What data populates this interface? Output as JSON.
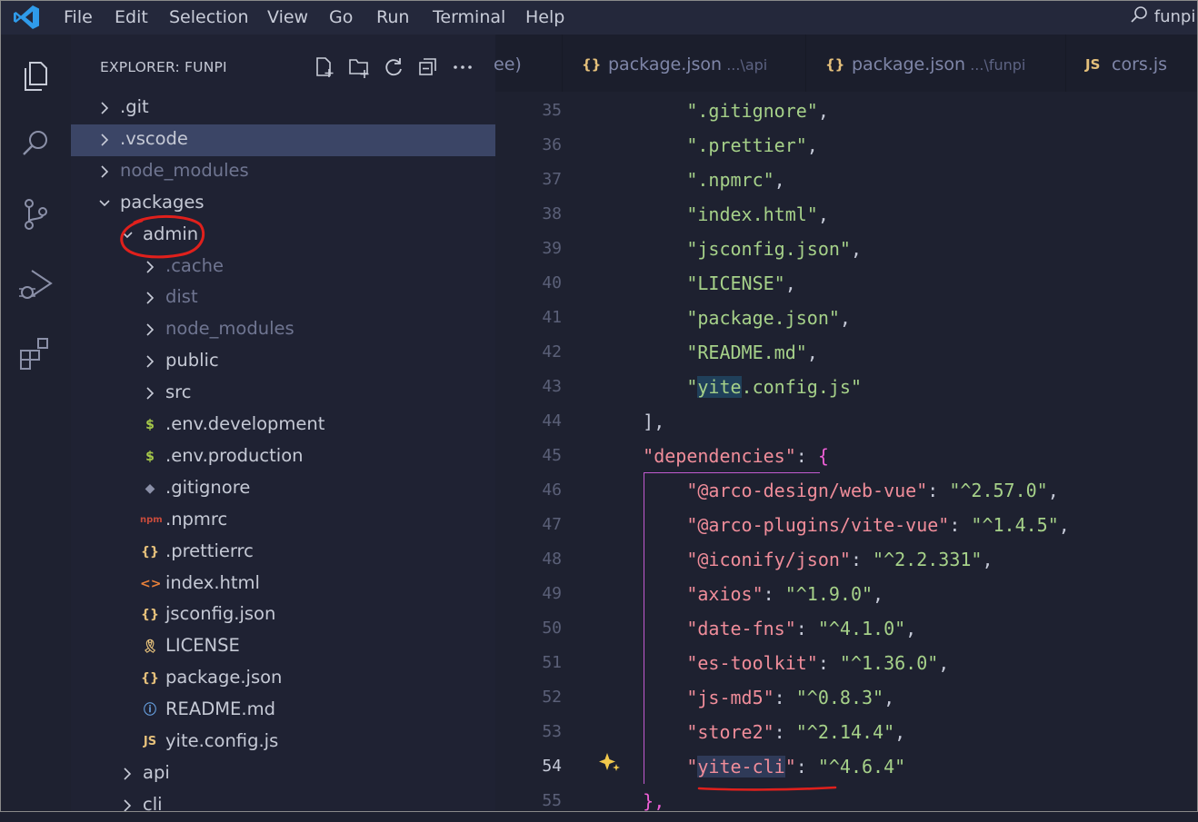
{
  "titlebar": {
    "menu": [
      "File",
      "Edit",
      "Selection",
      "View",
      "Go",
      "Run",
      "Terminal",
      "Help"
    ],
    "search_text": "funpi"
  },
  "activitybar": {
    "items": [
      "explorer-icon",
      "search-icon",
      "source-control-icon",
      "run-debug-icon",
      "extensions-icon"
    ]
  },
  "sidebar": {
    "title": "EXPLORER: FUNPI",
    "actions": [
      "new-file-icon",
      "new-folder-icon",
      "refresh-icon",
      "collapse-all-icon",
      "more-icon"
    ],
    "tree": [
      {
        "label": ".git",
        "kind": "folder",
        "expanded": false
      },
      {
        "label": ".vscode",
        "kind": "folder",
        "expanded": false,
        "selected": true
      },
      {
        "label": "node_modules",
        "kind": "folder",
        "expanded": false,
        "dim": true
      },
      {
        "label": "packages",
        "kind": "folder",
        "expanded": true
      },
      {
        "label": "admin",
        "kind": "folder",
        "expanded": true
      },
      {
        "label": ".cache",
        "kind": "folder",
        "expanded": false,
        "dim": true
      },
      {
        "label": "dist",
        "kind": "folder",
        "expanded": false,
        "dim": true
      },
      {
        "label": "node_modules",
        "kind": "folder",
        "expanded": false,
        "dim": true
      },
      {
        "label": "public",
        "kind": "folder",
        "expanded": false
      },
      {
        "label": "src",
        "kind": "folder",
        "expanded": false
      },
      {
        "label": ".env.development",
        "kind": "env",
        "glyph": "$"
      },
      {
        "label": ".env.production",
        "kind": "env",
        "glyph": "$"
      },
      {
        "label": ".gitignore",
        "kind": "git",
        "glyph": "◆"
      },
      {
        "label": ".npmrc",
        "kind": "npm",
        "glyph": "npm"
      },
      {
        "label": ".prettierrc",
        "kind": "json",
        "glyph": "{}"
      },
      {
        "label": "index.html",
        "kind": "html",
        "glyph": "<>"
      },
      {
        "label": "jsconfig.json",
        "kind": "json",
        "glyph": "{}"
      },
      {
        "label": "LICENSE",
        "kind": "license",
        "glyph": "🎗"
      },
      {
        "label": "package.json",
        "kind": "json",
        "glyph": "{}"
      },
      {
        "label": "README.md",
        "kind": "info",
        "glyph": "ⓘ"
      },
      {
        "label": "yite.config.js",
        "kind": "js",
        "glyph": "JS"
      },
      {
        "label": "api",
        "kind": "folder",
        "expanded": false
      },
      {
        "label": "cli",
        "kind": "folder",
        "expanded": false
      }
    ]
  },
  "tabs": [
    {
      "name": "ee)",
      "path": "",
      "icon": ""
    },
    {
      "name": "package.json",
      "path": "...\\api",
      "icon": "{}"
    },
    {
      "name": "package.json",
      "path": "...\\funpi",
      "icon": "{}"
    },
    {
      "name": "cors.js",
      "path": "",
      "icon": "JS"
    }
  ],
  "code": {
    "active_line": "54",
    "lines": [
      {
        "n": "35",
        "parts": [
          {
            "t": "        "
          },
          {
            "t": "\".gitignore\"",
            "c": "str"
          },
          {
            "t": ",",
            "c": "pun"
          }
        ]
      },
      {
        "n": "36",
        "parts": [
          {
            "t": "        "
          },
          {
            "t": "\".prettier\"",
            "c": "str"
          },
          {
            "t": ",",
            "c": "pun"
          }
        ]
      },
      {
        "n": "37",
        "parts": [
          {
            "t": "        "
          },
          {
            "t": "\".npmrc\"",
            "c": "str"
          },
          {
            "t": ",",
            "c": "pun"
          }
        ]
      },
      {
        "n": "38",
        "parts": [
          {
            "t": "        "
          },
          {
            "t": "\"index.html\"",
            "c": "str"
          },
          {
            "t": ",",
            "c": "pun"
          }
        ]
      },
      {
        "n": "39",
        "parts": [
          {
            "t": "        "
          },
          {
            "t": "\"jsconfig.json\"",
            "c": "str"
          },
          {
            "t": ",",
            "c": "pun"
          }
        ]
      },
      {
        "n": "40",
        "parts": [
          {
            "t": "        "
          },
          {
            "t": "\"LICENSE\"",
            "c": "str"
          },
          {
            "t": ",",
            "c": "pun"
          }
        ]
      },
      {
        "n": "41",
        "parts": [
          {
            "t": "        "
          },
          {
            "t": "\"package.json\"",
            "c": "str"
          },
          {
            "t": ",",
            "c": "pun"
          }
        ]
      },
      {
        "n": "42",
        "parts": [
          {
            "t": "        "
          },
          {
            "t": "\"README.md\"",
            "c": "str"
          },
          {
            "t": ",",
            "c": "pun"
          }
        ]
      },
      {
        "n": "43",
        "parts": [
          {
            "t": "        "
          },
          {
            "t": "\"",
            "c": "str"
          },
          {
            "t": "yite",
            "c": "str",
            "hl": "hl"
          },
          {
            "t": ".config.js\"",
            "c": "str"
          }
        ]
      },
      {
        "n": "44",
        "parts": [
          {
            "t": "    "
          },
          {
            "t": "],",
            "c": "pun"
          }
        ]
      },
      {
        "n": "45",
        "parts": [
          {
            "t": "    "
          },
          {
            "t": "\"dependencies\"",
            "c": "key"
          },
          {
            "t": ": ",
            "c": "pun"
          },
          {
            "t": "{",
            "c": "brace"
          }
        ]
      },
      {
        "n": "46",
        "parts": [
          {
            "t": "        "
          },
          {
            "t": "\"@arco-design/web-vue\"",
            "c": "key"
          },
          {
            "t": ": ",
            "c": "pun"
          },
          {
            "t": "\"^2.57.0\"",
            "c": "str"
          },
          {
            "t": ",",
            "c": "pun"
          }
        ]
      },
      {
        "n": "47",
        "parts": [
          {
            "t": "        "
          },
          {
            "t": "\"@arco-plugins/vite-vue\"",
            "c": "key"
          },
          {
            "t": ": ",
            "c": "pun"
          },
          {
            "t": "\"^1.4.5\"",
            "c": "str"
          },
          {
            "t": ",",
            "c": "pun"
          }
        ]
      },
      {
        "n": "48",
        "parts": [
          {
            "t": "        "
          },
          {
            "t": "\"@iconify/json\"",
            "c": "key"
          },
          {
            "t": ": ",
            "c": "pun"
          },
          {
            "t": "\"^2.2.331\"",
            "c": "str"
          },
          {
            "t": ",",
            "c": "pun"
          }
        ]
      },
      {
        "n": "49",
        "parts": [
          {
            "t": "        "
          },
          {
            "t": "\"axios\"",
            "c": "key"
          },
          {
            "t": ": ",
            "c": "pun"
          },
          {
            "t": "\"^1.9.0\"",
            "c": "str"
          },
          {
            "t": ",",
            "c": "pun"
          }
        ]
      },
      {
        "n": "50",
        "parts": [
          {
            "t": "        "
          },
          {
            "t": "\"date-fns\"",
            "c": "key"
          },
          {
            "t": ": ",
            "c": "pun"
          },
          {
            "t": "\"^4.1.0\"",
            "c": "str"
          },
          {
            "t": ",",
            "c": "pun"
          }
        ]
      },
      {
        "n": "51",
        "parts": [
          {
            "t": "        "
          },
          {
            "t": "\"es-toolkit\"",
            "c": "key"
          },
          {
            "t": ": ",
            "c": "pun"
          },
          {
            "t": "\"^1.36.0\"",
            "c": "str"
          },
          {
            "t": ",",
            "c": "pun"
          }
        ]
      },
      {
        "n": "52",
        "parts": [
          {
            "t": "        "
          },
          {
            "t": "\"js-md5\"",
            "c": "key"
          },
          {
            "t": ": ",
            "c": "pun"
          },
          {
            "t": "\"^0.8.3\"",
            "c": "str"
          },
          {
            "t": ",",
            "c": "pun"
          }
        ]
      },
      {
        "n": "53",
        "parts": [
          {
            "t": "        "
          },
          {
            "t": "\"store2\"",
            "c": "key"
          },
          {
            "t": ": ",
            "c": "pun"
          },
          {
            "t": "\"^2.14.4\"",
            "c": "str"
          },
          {
            "t": ",",
            "c": "pun"
          }
        ]
      },
      {
        "n": "54",
        "parts": [
          {
            "t": "        "
          },
          {
            "t": "\"",
            "c": "key"
          },
          {
            "t": "yite-cli",
            "c": "key",
            "hl": "hl2"
          },
          {
            "t": "\"",
            "c": "key"
          },
          {
            "t": ": ",
            "c": "pun"
          },
          {
            "t": "\"^4.6.4\"",
            "c": "str"
          }
        ]
      },
      {
        "n": "55",
        "parts": [
          {
            "t": "    "
          },
          {
            "t": "},",
            "c": "brace"
          }
        ]
      }
    ]
  },
  "colors": {
    "annotation_red": "#e0201c",
    "selection": "#3b4566",
    "string": "#a6d189",
    "key": "#f08d9a",
    "bracket": "#ee5fd6",
    "sparkle": "#f2c94c"
  }
}
